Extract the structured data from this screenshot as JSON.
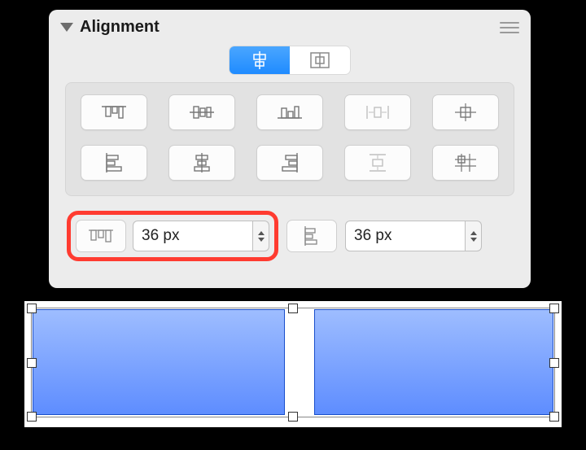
{
  "panel": {
    "title": "Alignment",
    "segmented": {
      "mode_a_active": true
    }
  },
  "spacing": {
    "horizontal": {
      "value": "36 px"
    },
    "vertical": {
      "value": "36 px"
    }
  },
  "canvas": {
    "shapes": [
      {
        "fill": "blue-gradient"
      },
      {
        "fill": "blue-gradient"
      }
    ]
  }
}
